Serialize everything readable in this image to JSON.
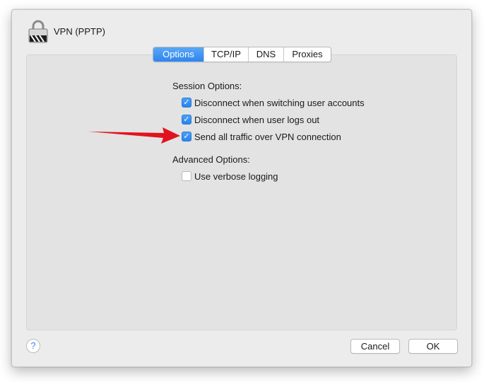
{
  "dialog": {
    "title": "VPN (PPTP)",
    "icon": "lock-icon"
  },
  "tabs": [
    {
      "label": "Options",
      "selected": true
    },
    {
      "label": "TCP/IP",
      "selected": false
    },
    {
      "label": "DNS",
      "selected": false
    },
    {
      "label": "Proxies",
      "selected": false
    }
  ],
  "session": {
    "heading": "Session Options:",
    "options": [
      {
        "label": "Disconnect when switching user accounts",
        "checked": true
      },
      {
        "label": "Disconnect when user logs out",
        "checked": true
      },
      {
        "label": "Send all traffic over VPN connection",
        "checked": true
      }
    ]
  },
  "advanced": {
    "heading": "Advanced Options:",
    "options": [
      {
        "label": "Use verbose logging",
        "checked": false
      }
    ]
  },
  "footer": {
    "help_label": "?",
    "cancel_label": "Cancel",
    "ok_label": "OK"
  },
  "colors": {
    "accent": "#2c85f0",
    "arrow": "#e0141e"
  }
}
